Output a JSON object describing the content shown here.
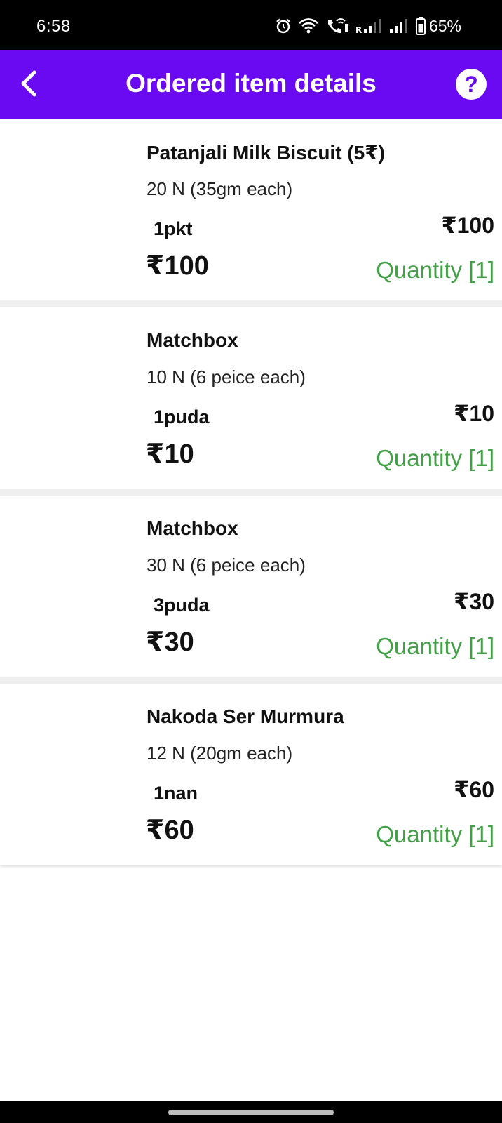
{
  "status_bar": {
    "time": "6:58",
    "battery": "65%",
    "icons": [
      "alarm-icon",
      "wifi-icon",
      "wifi-calling-icon",
      "signal-r-icon",
      "signal-icon",
      "battery-icon"
    ]
  },
  "header": {
    "back_icon": "chevron-left-icon",
    "title": "Ordered item details",
    "help_icon": "question-icon",
    "help_glyph": "?",
    "background": "#6a0af2"
  },
  "colors": {
    "accent": "#6a0af2",
    "quantity_green": "#43a047"
  },
  "items": [
    {
      "name": "Patanjali Milk Biscuit (5₹)",
      "description": "20 N (35gm each)",
      "unit": "1pkt",
      "unit_price": "₹100",
      "total": "₹100",
      "quantity": "Quantity [1]"
    },
    {
      "name": "Matchbox",
      "description": "10 N (6 peice each)",
      "unit": "1puda",
      "unit_price": "₹10",
      "total": "₹10",
      "quantity": "Quantity [1]"
    },
    {
      "name": "Matchbox",
      "description": "30 N (6 peice each)",
      "unit": "3puda",
      "unit_price": "₹30",
      "total": "₹30",
      "quantity": "Quantity [1]"
    },
    {
      "name": "Nakoda Ser Murmura",
      "description": "12 N (20gm each)",
      "unit": "1nan",
      "unit_price": "₹60",
      "total": "₹60",
      "quantity": "Quantity [1]"
    }
  ]
}
